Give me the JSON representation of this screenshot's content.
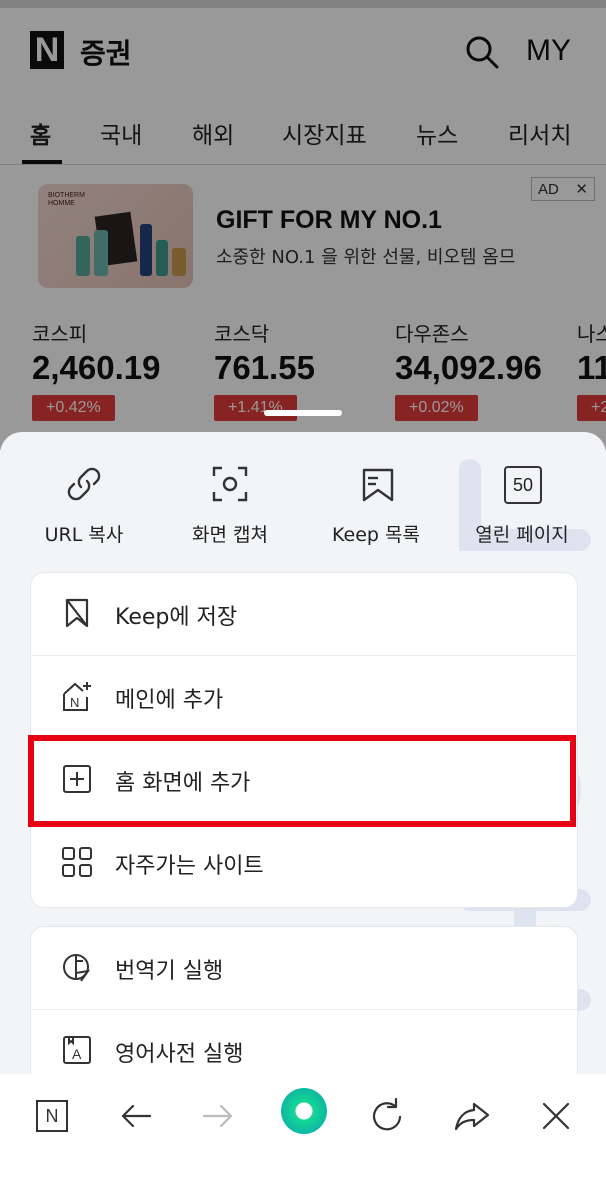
{
  "header": {
    "logo_letter": "N",
    "logo_text": "증권",
    "my_label": "MY"
  },
  "tabs": [
    {
      "label": "홈",
      "active": true
    },
    {
      "label": "국내"
    },
    {
      "label": "해외"
    },
    {
      "label": "시장지표"
    },
    {
      "label": "뉴스"
    },
    {
      "label": "리서치"
    }
  ],
  "ad": {
    "brand_text": "BIOTHERM HOMME",
    "title": "GIFT FOR MY NO.1",
    "subtitle": "소중한 NO.1 을 위한 선물, 비오템 옴므",
    "badge": "AD",
    "close": "✕"
  },
  "stocks": [
    {
      "name": "코스피",
      "value": "2,460.19",
      "change": "+0.42%"
    },
    {
      "name": "코스닥",
      "value": "761.55",
      "change": "+1.41%"
    },
    {
      "name": "다우존스",
      "value": "34,092.96",
      "change": "+0.02%"
    },
    {
      "name": "나스",
      "value": "11",
      "change": "+2"
    }
  ],
  "quick_actions": [
    {
      "label": "URL 복사",
      "icon": "link-icon"
    },
    {
      "label": "화면 캡쳐",
      "icon": "capture-icon"
    },
    {
      "label": "Keep 목록",
      "icon": "keep-list-icon"
    },
    {
      "label": "열린 페이지",
      "icon": "open-pages-icon",
      "count": "50"
    }
  ],
  "menu_group1": [
    {
      "label": "Keep에 저장",
      "icon": "keep-bookmark-icon"
    },
    {
      "label": "메인에 추가",
      "icon": "add-main-icon",
      "icon_letter": "N"
    },
    {
      "label": "홈 화면에 추가",
      "icon": "add-home-screen-icon",
      "highlighted": true
    },
    {
      "label": "자주가는 사이트",
      "icon": "grid-icon"
    }
  ],
  "menu_group2": [
    {
      "label": "번역기 실행",
      "icon": "translate-icon"
    },
    {
      "label": "영어사전 실행",
      "icon": "dictionary-icon",
      "icon_letter": "A"
    }
  ],
  "toolbar": {
    "home_letter": "N"
  },
  "colors": {
    "highlight": "#e60012",
    "change_badge": "#e23b3b",
    "green_button": "#17d694"
  }
}
